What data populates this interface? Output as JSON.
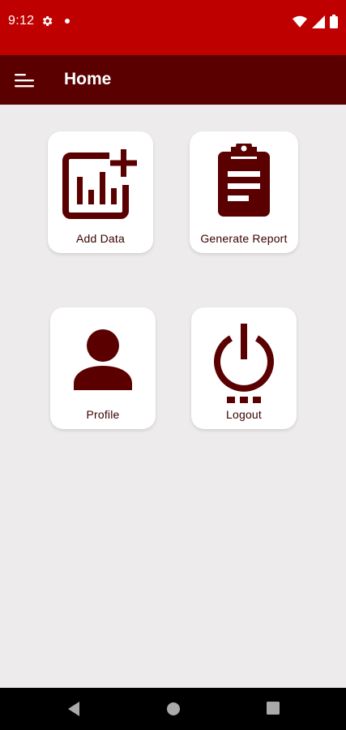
{
  "status_bar": {
    "time": "9:12",
    "icons": [
      "gear-icon",
      "notification-dot-icon",
      "wifi-icon",
      "signal-icon",
      "battery-icon"
    ]
  },
  "app_bar": {
    "title": "Home",
    "menu_icon": "menu-icon",
    "background": "#5a0000"
  },
  "tiles": [
    {
      "label": "Add Data",
      "icon": "add-chart-icon"
    },
    {
      "label": "Generate Report",
      "icon": "clipboard-icon"
    },
    {
      "label": "Profile",
      "icon": "person-icon"
    },
    {
      "label": "Logout",
      "icon": "power-icon"
    }
  ],
  "nav_bar": {
    "buttons": [
      "back-icon",
      "home-icon",
      "recents-icon"
    ]
  },
  "colors": {
    "status_bar": "#bf0000",
    "app_bar": "#5a0000",
    "icon_color": "#5a0000",
    "background": "#edebeb"
  }
}
